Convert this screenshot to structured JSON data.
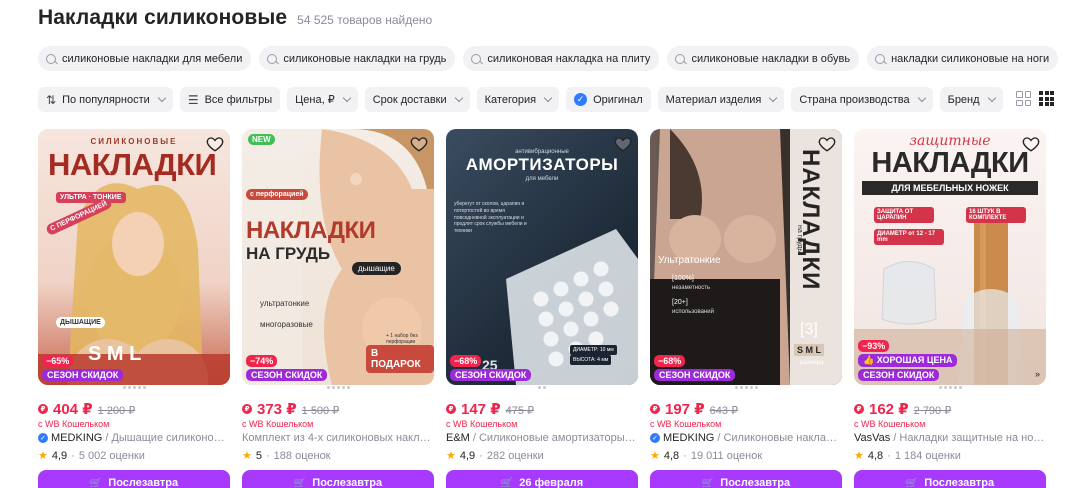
{
  "header": {
    "title": "Накладки силиконовые",
    "count": "54 525 товаров найдено"
  },
  "chips": [
    "силиконовые накладки для мебели",
    "силиконовые накладки на грудь",
    "силиконовая накладка на плиту",
    "силиконовые накладки в обувь",
    "накладки силиконовые на ноги"
  ],
  "filters": {
    "sort": "По популярности",
    "all": "Все фильтры",
    "price": "Цена, ₽",
    "delivery": "Срок доставки",
    "category": "Категория",
    "original": "Оригинал",
    "material": "Материал изделия",
    "country": "Страна производства",
    "brand": "Бренд"
  },
  "wallet_note": "с WB Кошельком",
  "products": [
    {
      "art": {
        "top": "СИЛИКОНОВЫЕ",
        "main": "НАКЛАДКИ",
        "tags": "УЛЬТРА · ТОНКИЕ",
        "side": "С ПЕРФОРАЦИЕЙ",
        "bottom": "ДЫШАЩИЕ",
        "extra": "S M L"
      },
      "discount": "−65%",
      "season": "СЕЗОН СКИДОК",
      "price": "404 ₽",
      "old_price": "1 200 ₽",
      "brand": "MEDKING",
      "verified": true,
      "title": " / Дышащие силиконовые н…",
      "rating": "4,9",
      "reviews": "5 002 оценки",
      "button": "Послезавтра"
    },
    {
      "art": {
        "new": "NEW",
        "perf": "с перфорацией",
        "main": "НАКЛАДКИ",
        "sub": "НА ГРУДЬ",
        "l1": "ультратонкие",
        "l2": "многоразовые",
        "breath": "дышащие",
        "gift_note": "+ 1 набор без перфорации",
        "gift": "В ПОДАРОК"
      },
      "discount": "−74%",
      "season": "СЕЗОН СКИДОК",
      "price": "373 ₽",
      "old_price": "1 500 ₽",
      "brand": "",
      "verified": false,
      "title": "Комплект из 4-х силиконовых накладок…",
      "rating": "5",
      "reviews": "188 оценок",
      "button": "Послезавтра"
    },
    {
      "art": {
        "top": "антивибрационные",
        "main": "АМОРТИЗАТОРЫ",
        "sub": "для мебели",
        "desc": "уберегут от сколов, царапин и потертостей во время повседневной эксплуатации и продлят срок службы мебели и техники",
        "spec1": "ДИАМЕТР: 10 мм",
        "spec2": "ВЫСОТА: 4 мм",
        "num": "25"
      },
      "discount": "−68%",
      "season": "СЕЗОН СКИДОК",
      "price": "147 ₽",
      "old_price": "475 ₽",
      "brand": "E&M",
      "verified": false,
      "title": " / Силиконовые амортизаторы (де…",
      "rating": "4,9",
      "reviews": "282 оценки",
      "button": "26 февраля"
    },
    {
      "art": {
        "main": "НАКЛАДКИ",
        "sub": "на грудь",
        "ultra": "Ультратонкие",
        "f1": "[100%]",
        "f1t": "незаметность",
        "f2": "[20+]",
        "f2t": "использований",
        "pack": "[3]",
        "sizes": "S M L",
        "pack_t": "размера"
      },
      "discount": "−68%",
      "season": "СЕЗОН СКИДОК",
      "price": "197 ₽",
      "old_price": "643 ₽",
      "brand": "MEDKING",
      "verified": true,
      "title": " / Силиконовые накладки на…",
      "rating": "4,8",
      "reviews": "19 011 оценок",
      "button": "Послезавтра"
    },
    {
      "art": {
        "top": "защитные",
        "main": "НАКЛАДКИ",
        "sub": "ДЛЯ МЕБЕЛЬНЫХ НОЖЕК",
        "b1": "ЗАЩИТА ОТ ЦАРАПИН",
        "b2": "16 ШТУК В КОМПЛЕКТЕ",
        "b3": "ДИАМЕТР от 12 - 17 mm"
      },
      "discount": "−93%",
      "season": "СЕЗОН СКИДОК",
      "good_price": "ХОРОШАЯ ЦЕНА",
      "price": "162 ₽",
      "old_price": "2 790 ₽",
      "brand": "VasVas",
      "verified": false,
      "title": " / Накладки защитные на ножки …",
      "rating": "4,8",
      "reviews": "1 184 оценки",
      "button": "Послезавтра"
    }
  ]
}
